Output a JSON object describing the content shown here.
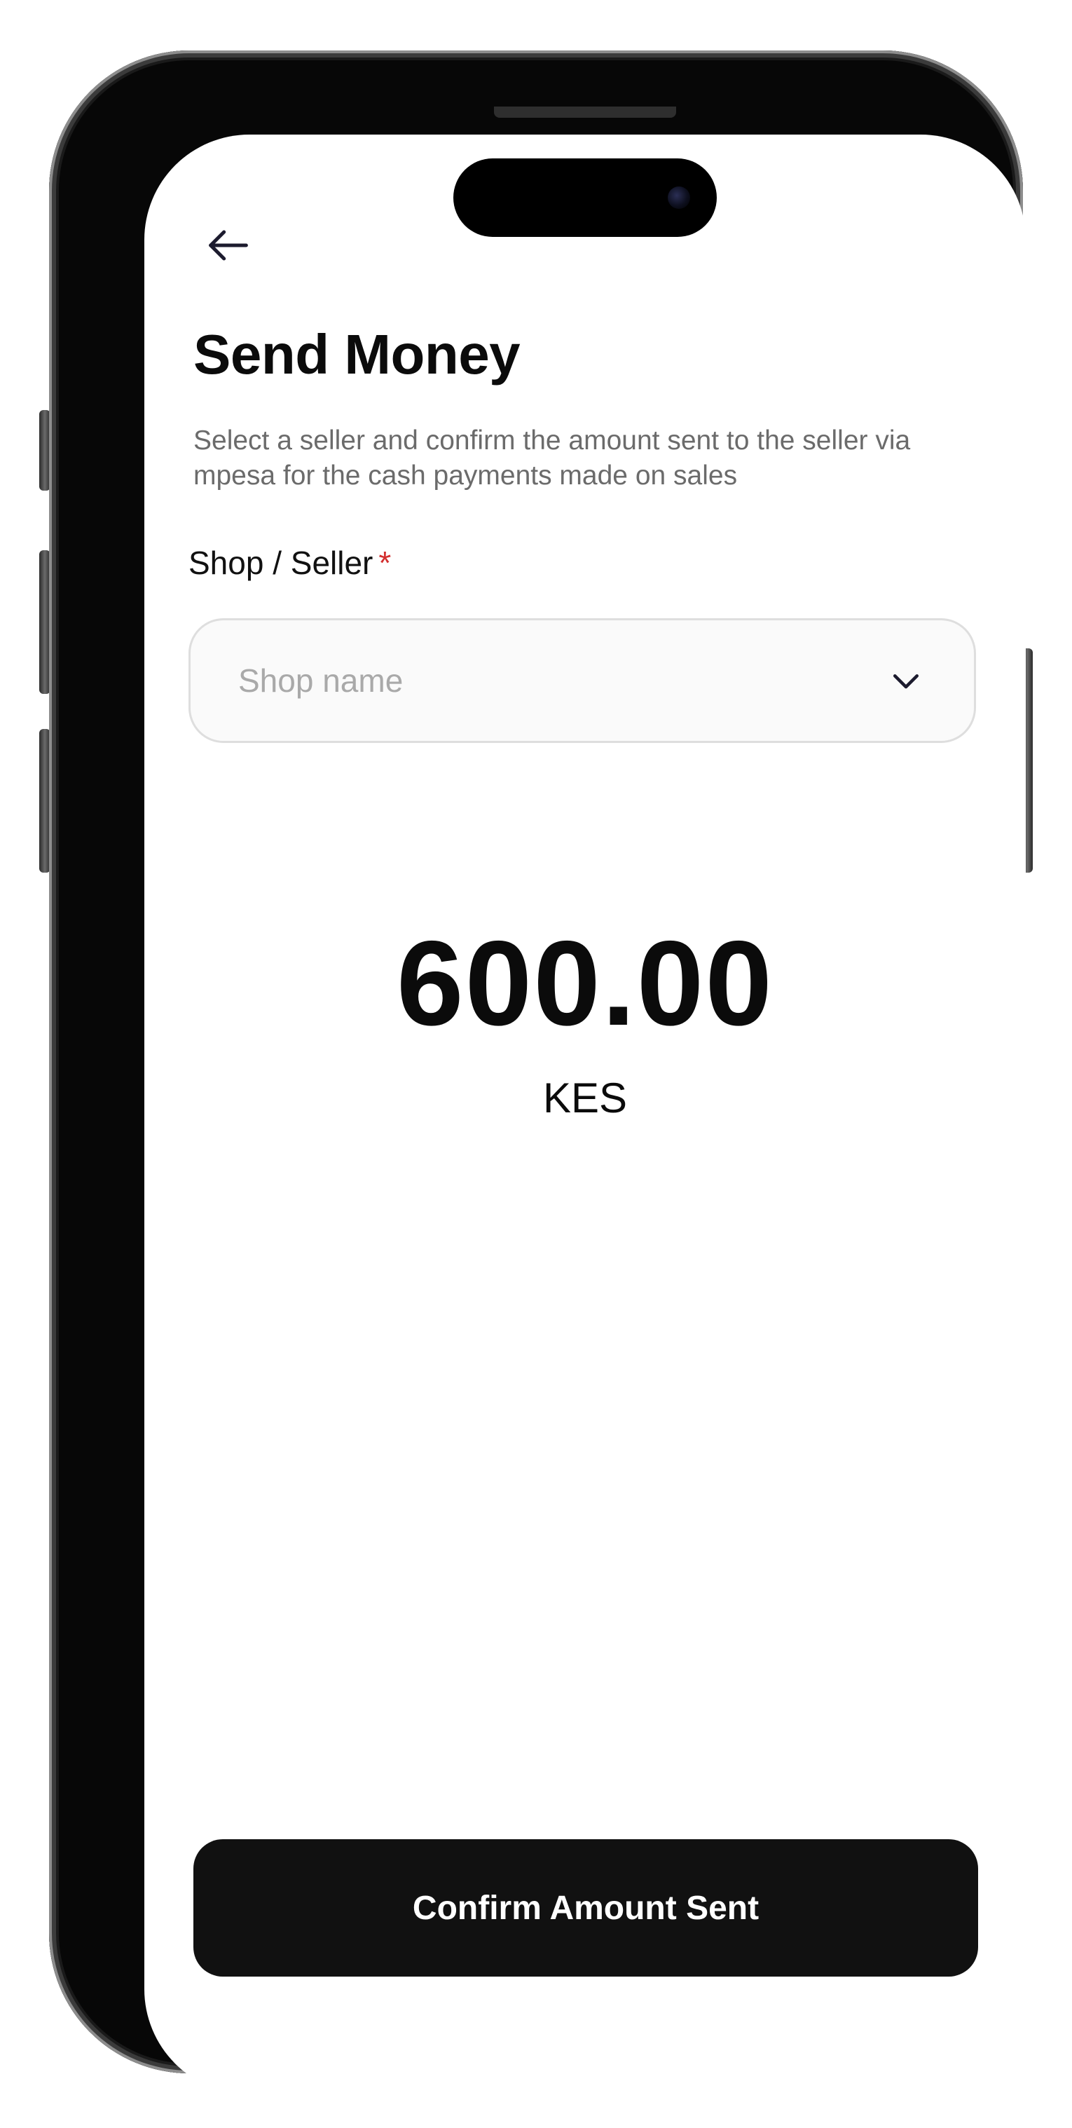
{
  "header": {
    "back_icon": "arrow-left-icon",
    "title": "Send Money",
    "description": "Select a seller and confirm the  amount sent to the seller via mpesa for the cash payments made on sales"
  },
  "form": {
    "shop_label": "Shop / Seller",
    "required_marker": "*",
    "shop_placeholder": "Shop name",
    "shop_value": "",
    "dropdown_icon": "chevron-down-icon"
  },
  "amount": {
    "value": "600.00",
    "currency": "KES"
  },
  "actions": {
    "confirm_label": "Confirm Amount Sent"
  },
  "colors": {
    "primary_button": "#111111",
    "required": "#d32f2f",
    "placeholder": "#a9a9a9"
  }
}
